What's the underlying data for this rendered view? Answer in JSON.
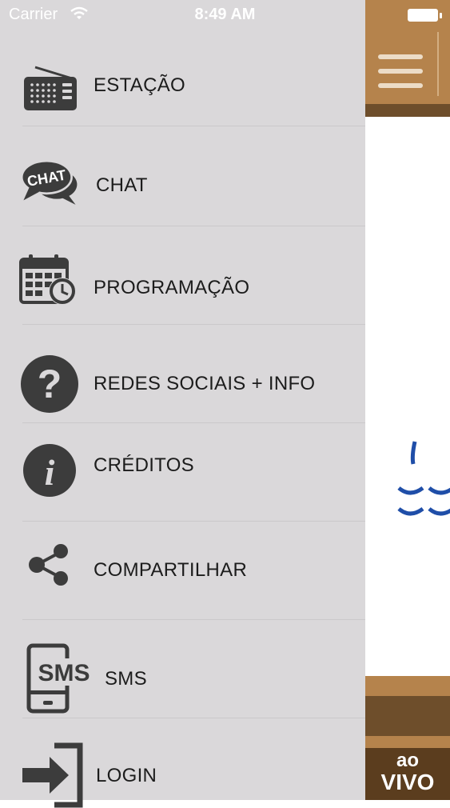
{
  "status_bar": {
    "carrier": "Carrier",
    "time": "8:49 AM"
  },
  "menu": {
    "items": [
      {
        "id": "estacao",
        "label": "ESTAÇÃO",
        "icon": "radio-icon"
      },
      {
        "id": "chat",
        "label": "CHAT",
        "icon": "chat-bubble-icon",
        "icon_text": "CHAT"
      },
      {
        "id": "programacao",
        "label": "PROGRAMAÇÃO",
        "icon": "calendar-clock-icon"
      },
      {
        "id": "redes",
        "label": "REDES SOCIAIS + INFO",
        "icon": "question-circle-icon",
        "icon_text": "?"
      },
      {
        "id": "creditos",
        "label": "CRÉDITOS",
        "icon": "info-circle-icon",
        "icon_text": "i"
      },
      {
        "id": "compartilhar",
        "label": "COMPARTILHAR",
        "icon": "share-icon"
      },
      {
        "id": "sms",
        "label": "SMS",
        "icon": "sms-phone-icon",
        "icon_text": "SMS"
      },
      {
        "id": "login",
        "label": "LOGIN",
        "icon": "login-arrow-icon"
      }
    ]
  },
  "live_badge": {
    "line1": "ao",
    "line2": "VIVO"
  },
  "colors": {
    "drawer_bg": "#dad8da",
    "icon_dark": "#3c3c3c",
    "brand_brown": "#b5834c",
    "brand_dark_brown": "#6e4e2b",
    "wave_blue": "#1f4ea8"
  }
}
